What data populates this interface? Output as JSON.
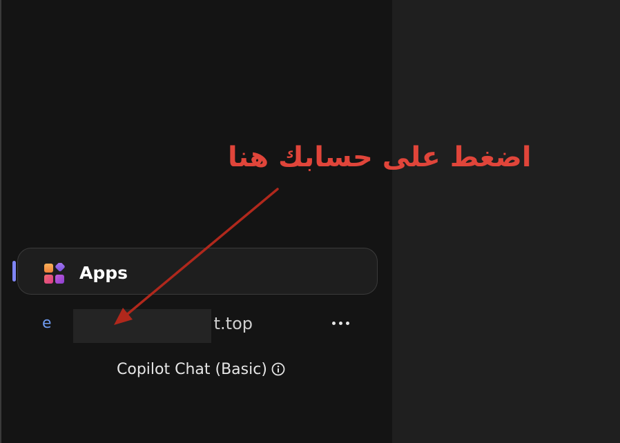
{
  "sidebar": {
    "apps": {
      "label": "Apps",
      "icon": "apps-grid-icon",
      "active": true
    },
    "account": {
      "initial": "e",
      "email_visible_suffix": "t.top",
      "email_redacted": true,
      "more_icon": "more-horizontal-icon"
    },
    "plan": {
      "label": "Copilot Chat (Basic)",
      "icon": "info-icon"
    }
  },
  "annotation": {
    "text": "اضغط على حسابك هنا",
    "arrow_target": "account-row"
  },
  "colors": {
    "sidebar_bg": "#141414",
    "main_bg": "#1f1f1f",
    "active_indicator": "#7f85f5",
    "account_initial": "#6f9bf0",
    "annotation_text": "#e0453a",
    "annotation_arrow": "#b0281c",
    "apps_icon_orange": "#f5a04a",
    "apps_icon_pink": "#e24b8a",
    "apps_icon_purple": "#9b4bd8"
  }
}
